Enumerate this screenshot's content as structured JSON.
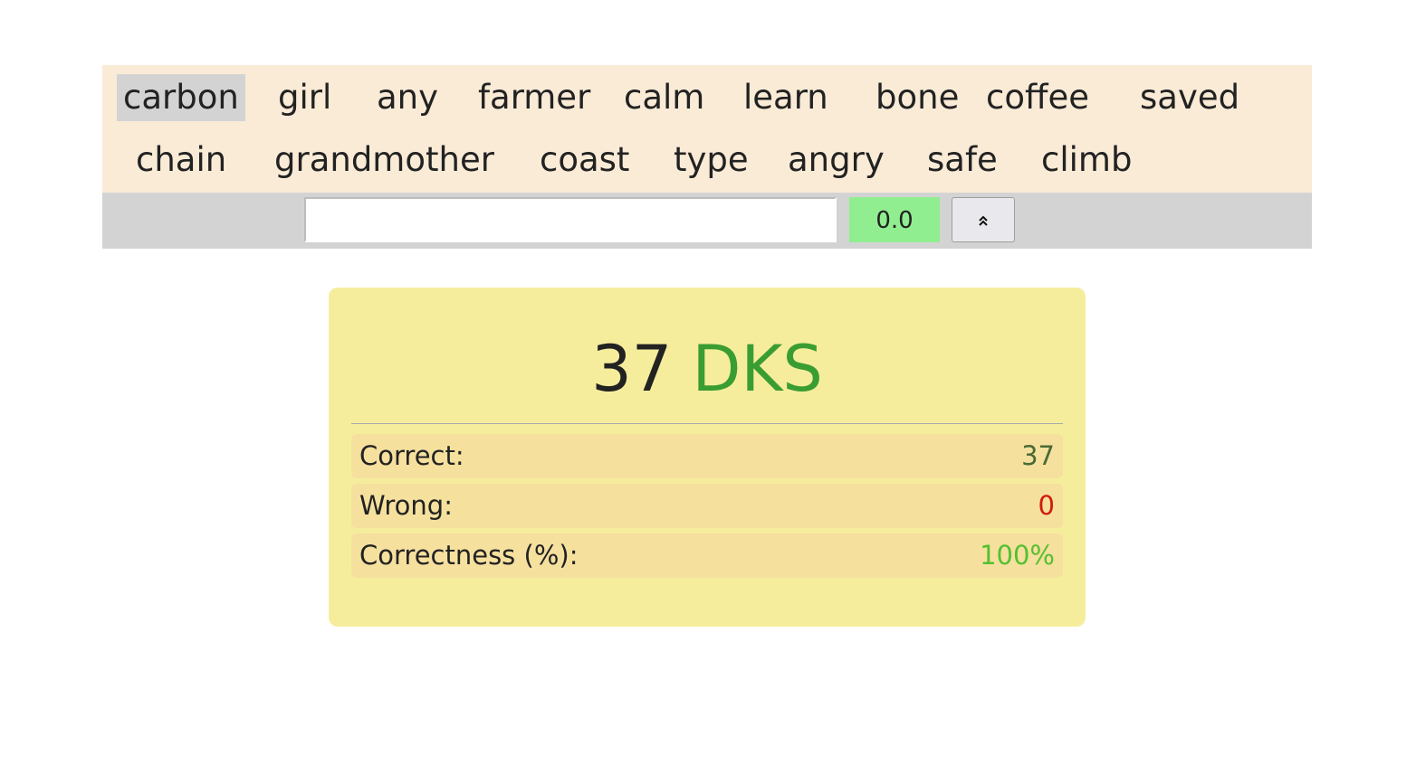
{
  "words": {
    "row1": [
      "carbon",
      "girl",
      "any",
      "farmer",
      "calm",
      "learn",
      "bone",
      "coffee",
      "saved"
    ],
    "row2": [
      "chain",
      "grandmother",
      "coast",
      "type",
      "angry",
      "safe",
      "climb"
    ],
    "current_word": "carbon"
  },
  "input_bar": {
    "typing_value": "",
    "timer_value": "0.0",
    "toggle_icon": "chevron-double-up-icon"
  },
  "result": {
    "speed_value": "37",
    "speed_unit": "DKS",
    "rows": [
      {
        "label": "Correct:",
        "value": "37"
      },
      {
        "label": "Wrong:",
        "value": "0"
      },
      {
        "label": "Correctness (%):",
        "value": "100%"
      }
    ]
  },
  "colors": {
    "words_bg": "#faebd7",
    "current_word_bg": "#d3d3d3",
    "input_bar_bg": "#d3d3d3",
    "timer_bg": "#90ee90",
    "result_card_bg": "#f6ed9c",
    "stat_row_bg": "#f5e09e",
    "speed_unit_color": "#3a9d32",
    "correct_color": "#4a6a35",
    "wrong_color": "#d01b0a",
    "percent_color": "#55c030"
  }
}
